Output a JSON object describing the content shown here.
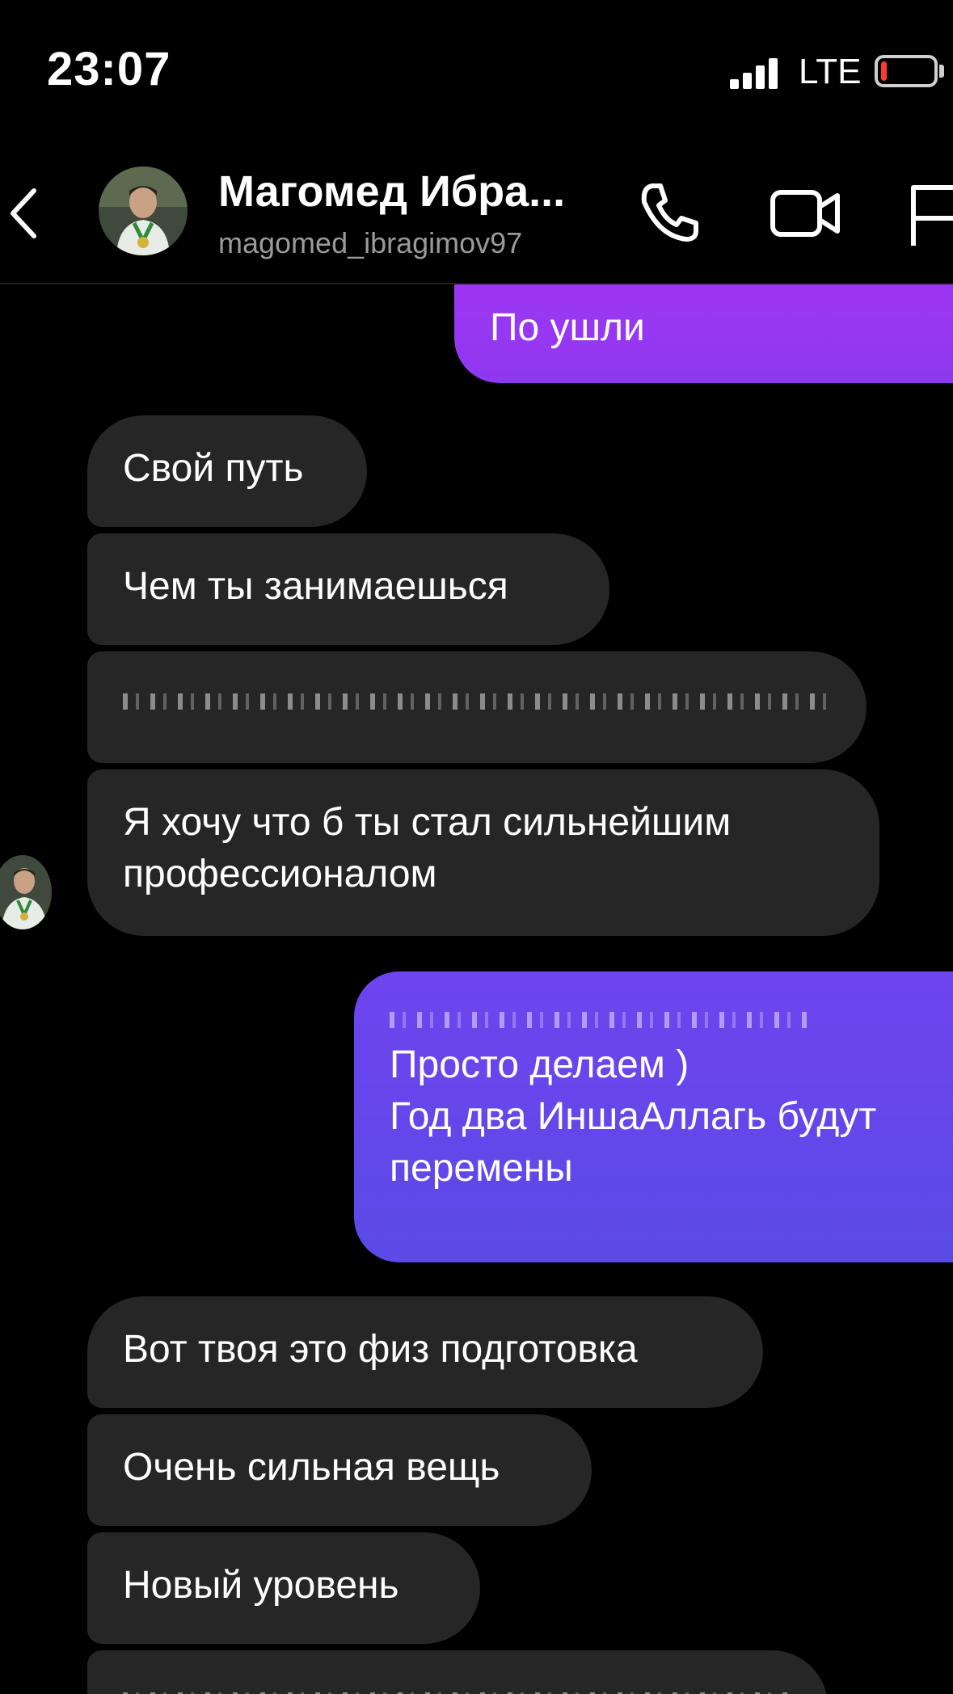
{
  "status_bar": {
    "time": "23:07",
    "network": "LTE",
    "battery_level": 0.12,
    "battery_color": "#ff3b30"
  },
  "header": {
    "back_icon": "chevron-left-icon",
    "name": "Магомед Ибра...",
    "username": "magomed_ibragimov97",
    "call_icon": "phone-icon",
    "video_icon": "video-camera-icon",
    "flag_icon": "flag-icon"
  },
  "colors": {
    "incoming_bubble": "#262626",
    "outgoing_gradient_top": "#9a32f0",
    "outgoing_gradient_bottom": "#5b47e6",
    "background": "#000000"
  },
  "messages": [
    {
      "direction": "out",
      "text": "По ушли"
    },
    {
      "direction": "in",
      "text": "Свой путь"
    },
    {
      "direction": "in",
      "text": "Чем ты занимаешься"
    },
    {
      "direction": "in",
      "text": "",
      "redacted": true
    },
    {
      "direction": "in",
      "lines": [
        "Я хочу что б ты стал сильнейшим",
        "профессионалом"
      ]
    },
    {
      "direction": "out",
      "redacted_first_line": true,
      "lines": [
        "Просто делаем )",
        "Год два ИншаАллагь будут",
        "перемены"
      ]
    },
    {
      "direction": "in",
      "text": "Вот твоя это физ подготовка"
    },
    {
      "direction": "in",
      "text": "Очень сильная вещь"
    },
    {
      "direction": "in",
      "text": "Новый уровень"
    },
    {
      "direction": "in",
      "text": "",
      "redacted": true
    }
  ]
}
